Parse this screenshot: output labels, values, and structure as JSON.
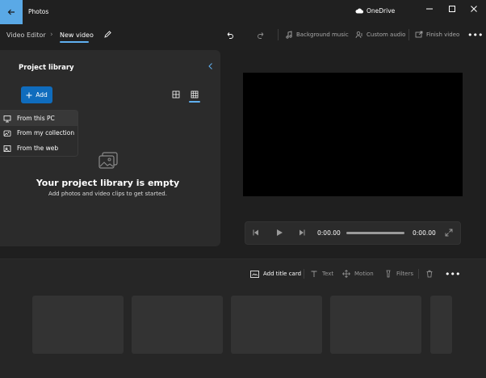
{
  "titlebar": {
    "app_title": "Photos",
    "onedrive_label": "OneDrive",
    "back_icon": "arrow-left-icon",
    "accent_color": "#5aa9e6"
  },
  "toolbar": {
    "breadcrumb_root": "Video Editor",
    "breadcrumb_current": "New video",
    "background_music": "Background music",
    "custom_audio": "Custom audio",
    "finish_video": "Finish video"
  },
  "library": {
    "title": "Project library",
    "add_label": "Add",
    "menu": [
      {
        "label": "From this PC",
        "icon": "pc-icon"
      },
      {
        "label": "From my collection",
        "icon": "collection-icon"
      },
      {
        "label": "From the web",
        "icon": "web-icon"
      }
    ],
    "empty_title": "Your project library is empty",
    "empty_subtitle": "Add photos and video clips to get started."
  },
  "player": {
    "time_current": "0:00.00",
    "time_total": "0:00.00",
    "progress": 0
  },
  "storyboard": {
    "add_title_card": "Add title card",
    "text": "Text",
    "motion": "Motion",
    "filters": "Filters"
  },
  "colors": {
    "accent": "#0f6cbd",
    "link": "#60b0f0",
    "background": "#1f1f1f",
    "panel": "#2b2b2b"
  }
}
